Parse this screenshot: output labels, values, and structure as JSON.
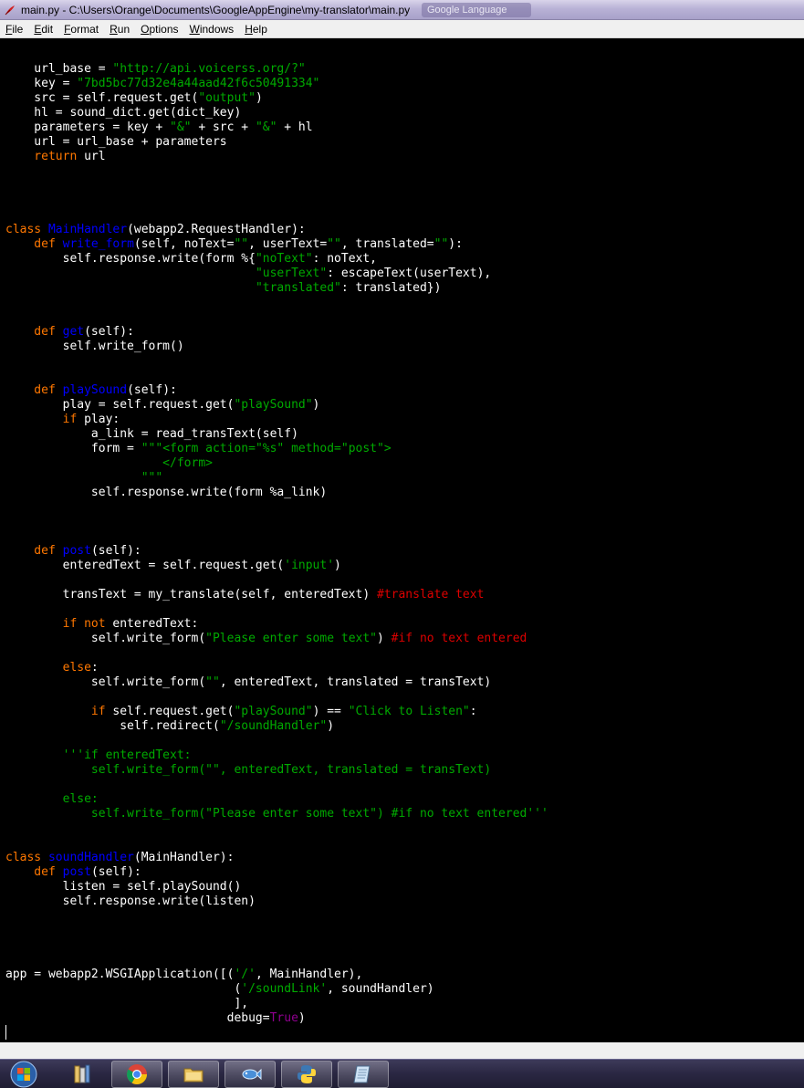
{
  "window": {
    "title": "main.py - C:\\Users\\Orange\\Documents\\GoogleAppEngine\\my-translator\\main.py",
    "background_tab_title": "Google Language"
  },
  "menu": {
    "items": [
      {
        "label": "File",
        "accel": "F",
        "rest": "ile"
      },
      {
        "label": "Edit",
        "accel": "E",
        "rest": "dit"
      },
      {
        "label": "Format",
        "accel": "F",
        "rest": "ormat"
      },
      {
        "label": "Run",
        "accel": "R",
        "rest": "un"
      },
      {
        "label": "Options",
        "accel": "O",
        "rest": "ptions"
      },
      {
        "label": "Windows",
        "accel": "W",
        "rest": "indows"
      },
      {
        "label": "Help",
        "accel": "H",
        "rest": "elp"
      }
    ]
  },
  "colors": {
    "keyword": "#ff7700",
    "definition": "#0000ff",
    "string": "#00aa00",
    "comment": "#dd0000",
    "builtin": "#900090",
    "text": "#ffffff",
    "background": "#000000"
  },
  "code": {
    "lines": [
      [
        [
          "str",
          "    \""
        ]
      ],
      [],
      [
        [
          "txt",
          "    url_base = "
        ],
        [
          "str",
          "\"http://api.voicerss.org/?\""
        ]
      ],
      [
        [
          "txt",
          "    key = "
        ],
        [
          "str",
          "\"7bd5bc77d32e4a44aad42f6c50491334\""
        ]
      ],
      [
        [
          "txt",
          "    src = self.request.get("
        ],
        [
          "str",
          "\"output\""
        ],
        [
          "txt",
          ")"
        ]
      ],
      [
        [
          "txt",
          "    hl = sound_dict.get(dict_key)"
        ]
      ],
      [
        [
          "txt",
          "    parameters = key + "
        ],
        [
          "str",
          "\"&\""
        ],
        [
          "txt",
          " + src + "
        ],
        [
          "str",
          "\"&\""
        ],
        [
          "txt",
          " + hl"
        ]
      ],
      [
        [
          "txt",
          "    url = url_base + parameters"
        ]
      ],
      [
        [
          "kw",
          "    return"
        ],
        [
          "txt",
          " url"
        ]
      ],
      [],
      [],
      [],
      [],
      [
        [
          "kw",
          "class"
        ],
        [
          "txt",
          " "
        ],
        [
          "def",
          "MainHandler"
        ],
        [
          "txt",
          "(webapp2.RequestHandler):"
        ]
      ],
      [
        [
          "kw",
          "    def"
        ],
        [
          "txt",
          " "
        ],
        [
          "def",
          "write_form"
        ],
        [
          "txt",
          "(self, noText="
        ],
        [
          "str",
          "\"\""
        ],
        [
          "txt",
          ", userText="
        ],
        [
          "str",
          "\"\""
        ],
        [
          "txt",
          ", translated="
        ],
        [
          "str",
          "\"\""
        ],
        [
          "txt",
          "):"
        ]
      ],
      [
        [
          "txt",
          "        self.response.write(form %{"
        ],
        [
          "str",
          "\"noText\""
        ],
        [
          "txt",
          ": noText,"
        ]
      ],
      [
        [
          "txt",
          "                                   "
        ],
        [
          "str",
          "\"userText\""
        ],
        [
          "txt",
          ": escapeText(userText),"
        ]
      ],
      [
        [
          "txt",
          "                                   "
        ],
        [
          "str",
          "\"translated\""
        ],
        [
          "txt",
          ": translated})"
        ]
      ],
      [],
      [],
      [
        [
          "kw",
          "    def"
        ],
        [
          "txt",
          " "
        ],
        [
          "def",
          "get"
        ],
        [
          "txt",
          "(self):"
        ]
      ],
      [
        [
          "txt",
          "        self.write_form()"
        ]
      ],
      [],
      [],
      [
        [
          "kw",
          "    def"
        ],
        [
          "txt",
          " "
        ],
        [
          "def",
          "playSound"
        ],
        [
          "txt",
          "(self):"
        ]
      ],
      [
        [
          "txt",
          "        play = self.request.get("
        ],
        [
          "str",
          "\"playSound\""
        ],
        [
          "txt",
          ")"
        ]
      ],
      [
        [
          "kw",
          "        if"
        ],
        [
          "txt",
          " play:"
        ]
      ],
      [
        [
          "txt",
          "            a_link = read_transText(self)"
        ]
      ],
      [
        [
          "txt",
          "            form = "
        ],
        [
          "str",
          "\"\"\"<form action=\"%s\" method=\"post\">"
        ]
      ],
      [
        [
          "str",
          "                      </form>"
        ]
      ],
      [
        [
          "str",
          "                   \"\"\""
        ]
      ],
      [
        [
          "txt",
          "            self.response.write(form %a_link)"
        ]
      ],
      [],
      [],
      [],
      [
        [
          "kw",
          "    def"
        ],
        [
          "txt",
          " "
        ],
        [
          "def",
          "post"
        ],
        [
          "txt",
          "(self):"
        ]
      ],
      [
        [
          "txt",
          "        enteredText = self.request.get("
        ],
        [
          "str",
          "'input'"
        ],
        [
          "txt",
          ")"
        ]
      ],
      [],
      [
        [
          "txt",
          "        transText = my_translate(self, enteredText) "
        ],
        [
          "cmt",
          "#translate text"
        ]
      ],
      [],
      [
        [
          "kw",
          "        if not"
        ],
        [
          "txt",
          " enteredText:"
        ]
      ],
      [
        [
          "txt",
          "            self.write_form("
        ],
        [
          "str",
          "\"Please enter some text\""
        ],
        [
          "txt",
          ") "
        ],
        [
          "cmt",
          "#if no text entered"
        ]
      ],
      [],
      [
        [
          "kw",
          "        else"
        ],
        [
          "txt",
          ":"
        ]
      ],
      [
        [
          "txt",
          "            self.write_form("
        ],
        [
          "str",
          "\"\""
        ],
        [
          "txt",
          ", enteredText, translated = transText)"
        ]
      ],
      [],
      [
        [
          "kw",
          "            if"
        ],
        [
          "txt",
          " self.request.get("
        ],
        [
          "str",
          "\"playSound\""
        ],
        [
          "txt",
          ") == "
        ],
        [
          "str",
          "\"Click to Listen\""
        ],
        [
          "txt",
          ":"
        ]
      ],
      [
        [
          "txt",
          "                self.redirect("
        ],
        [
          "str",
          "\"/soundHandler\""
        ],
        [
          "txt",
          ")"
        ]
      ],
      [],
      [
        [
          "str",
          "        '''if enteredText:"
        ]
      ],
      [
        [
          "str",
          "            self.write_form(\"\", enteredText, translated = transText)"
        ]
      ],
      [],
      [
        [
          "str",
          "        else:"
        ]
      ],
      [
        [
          "str",
          "            self.write_form(\"Please enter some text\") #if no text entered'''"
        ]
      ],
      [],
      [],
      [
        [
          "kw",
          "class"
        ],
        [
          "txt",
          " "
        ],
        [
          "def",
          "soundHandler"
        ],
        [
          "txt",
          "(MainHandler):"
        ]
      ],
      [
        [
          "kw",
          "    def"
        ],
        [
          "txt",
          " "
        ],
        [
          "def",
          "post"
        ],
        [
          "txt",
          "(self):"
        ]
      ],
      [
        [
          "txt",
          "        listen = self.playSound()"
        ]
      ],
      [
        [
          "txt",
          "        self.response.write(listen)"
        ]
      ],
      [],
      [],
      [],
      [],
      [
        [
          "txt",
          "app = webapp2.WSGIApplication([("
        ],
        [
          "str",
          "'/'"
        ],
        [
          "txt",
          ", MainHandler),"
        ]
      ],
      [
        [
          "txt",
          "                                ("
        ],
        [
          "str",
          "'/soundLink'"
        ],
        [
          "txt",
          ", soundHandler)"
        ]
      ],
      [
        [
          "txt",
          "                                ],"
        ]
      ],
      [
        [
          "txt",
          "                               debug="
        ],
        [
          "bi",
          "True"
        ],
        [
          "txt",
          ")"
        ]
      ]
    ]
  },
  "taskbar": {
    "items": [
      {
        "name": "start-orb",
        "icon": "windows-logo-icon",
        "state": "start"
      },
      {
        "name": "taskbar-explorer-libraries",
        "icon": "libraries-icon",
        "state": "pinned"
      },
      {
        "name": "taskbar-chrome",
        "icon": "chrome-icon",
        "state": "running"
      },
      {
        "name": "taskbar-file-manager",
        "icon": "folder-icon",
        "state": "running"
      },
      {
        "name": "taskbar-tool",
        "icon": "fish-icon",
        "state": "running"
      },
      {
        "name": "taskbar-python",
        "icon": "python-icon",
        "state": "running"
      },
      {
        "name": "taskbar-editor",
        "icon": "notepad-icon",
        "state": "running"
      }
    ]
  }
}
